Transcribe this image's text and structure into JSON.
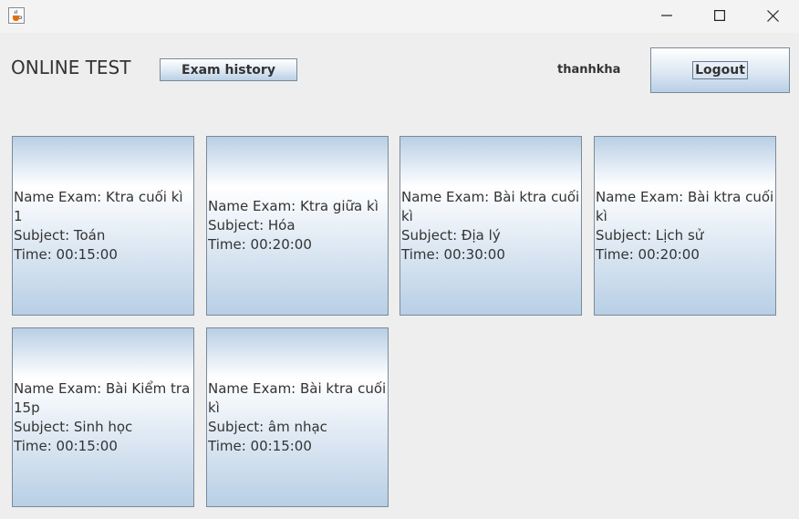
{
  "window": {
    "app_icon": "java-cup-icon",
    "controls": [
      "minimize-icon",
      "maximize-icon",
      "close-icon"
    ]
  },
  "header": {
    "title": "ONLINE TEST",
    "history_label": "Exam history",
    "username": "thanhkha",
    "logout_label": "Logout"
  },
  "exams": [
    {
      "name": "Name Exam: Ktra cuối kì 1",
      "subject": "Subject: Toán",
      "time": "Time: 00:15:00"
    },
    {
      "name": "Name Exam: Ktra giữa kì",
      "subject": "Subject: Hóa",
      "time": "Time: 00:20:00"
    },
    {
      "name": "Name Exam: Bài ktra cuối kì",
      "subject": "Subject: Địa lý",
      "time": "Time: 00:30:00"
    },
    {
      "name": "Name Exam: Bài ktra cuối kì",
      "subject": "Subject: Lịch sử",
      "time": "Time: 00:20:00"
    },
    {
      "name": "Name Exam: Bài Kiểm tra 15p",
      "subject": "Subject: Sinh học",
      "time": "Time: 00:15:00"
    },
    {
      "name": "Name Exam: Bài ktra cuối kì",
      "subject": "Subject: âm nhạc",
      "time": "Time: 00:15:00"
    }
  ],
  "colors": {
    "background": "#eeeeee",
    "card_gradient_light": "#ffffff",
    "card_gradient_blue": "#b8cfe5",
    "border": "#7a8a99",
    "text": "#333333"
  }
}
